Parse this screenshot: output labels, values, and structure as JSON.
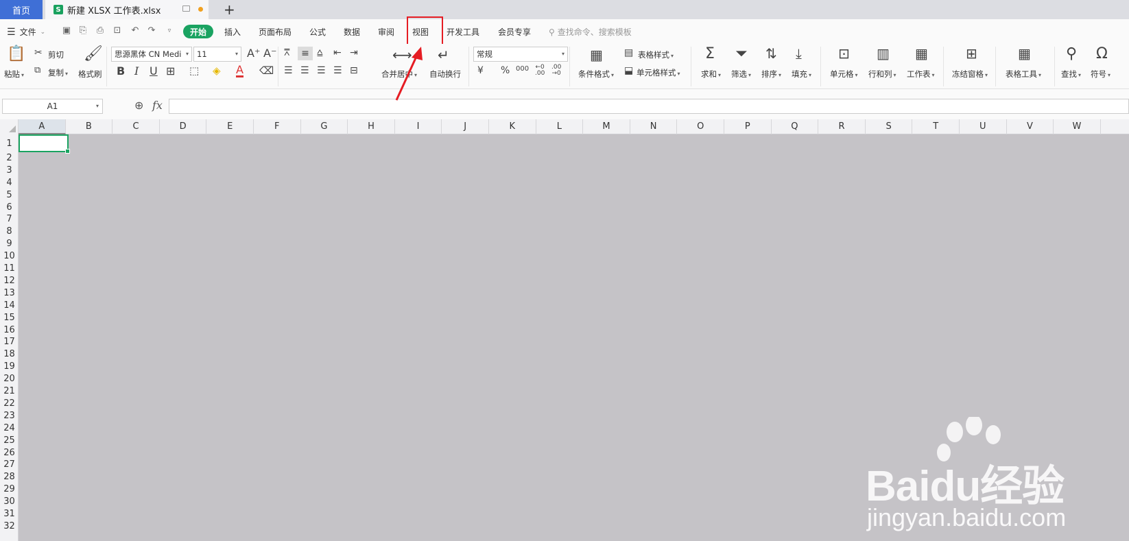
{
  "tabs": {
    "home": "首页",
    "file": "新建 XLSX 工作表.xlsx",
    "file_icon": "S",
    "new_tab": "+"
  },
  "menu": {
    "file": "文件",
    "start": "开始",
    "items": [
      "插入",
      "页面布局",
      "公式",
      "数据",
      "审阅",
      "视图",
      "开发工具",
      "会员专享"
    ],
    "search": "查找命令、搜索模板"
  },
  "ribbon": {
    "paste": "粘贴",
    "cut": "剪切",
    "copy": "复制",
    "format_painter": "格式刷",
    "font_name": "思源黑体 CN Medi",
    "font_size": "11",
    "merge": "合并居中",
    "wrap": "自动换行",
    "number_format": "常规",
    "conditional": "条件格式",
    "table_style": "表格样式",
    "cell_style": "单元格样式",
    "sum": "求和",
    "filter": "筛选",
    "sort": "排序",
    "fill": "填充",
    "cell": "单元格",
    "rowcol": "行和列",
    "sheet": "工作表",
    "freeze": "冻结窗格",
    "table_tools": "表格工具",
    "find": "查找",
    "symbol": "符号"
  },
  "formula_bar": {
    "name_box": "A1",
    "fx": "fx",
    "value": ""
  },
  "columns": [
    "A",
    "B",
    "C",
    "D",
    "E",
    "F",
    "G",
    "H",
    "I",
    "J",
    "K",
    "L",
    "M",
    "N",
    "O",
    "P",
    "Q",
    "R",
    "S",
    "T",
    "U",
    "V",
    "W"
  ],
  "rows": [
    "1",
    "2",
    "3",
    "4",
    "5",
    "6",
    "7",
    "8",
    "9",
    "10",
    "11",
    "12",
    "13",
    "14",
    "15",
    "16",
    "17",
    "18",
    "19",
    "20",
    "21",
    "22",
    "23",
    "24",
    "25",
    "26",
    "27",
    "28",
    "29",
    "30",
    "31",
    "32"
  ],
  "watermark": {
    "logo_text": "Baidu经验",
    "url": "jingyan.baidu.com"
  },
  "colors": {
    "accent": "#1aa361",
    "highlight": "#e51c23",
    "home_tab": "#3f6fd6"
  }
}
